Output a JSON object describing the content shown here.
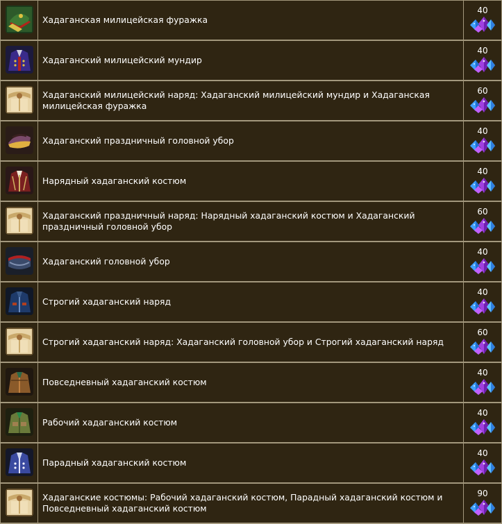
{
  "items": [
    {
      "name": "Хадаганская милицейская фуражка",
      "price": "40",
      "icon": "cap-icon"
    },
    {
      "name": "Хадаганский милицейский мундир",
      "price": "40",
      "icon": "uniform-icon"
    },
    {
      "name": "Хадаганский милицейский наряд: Хадаганский милицейский мундир и Хадаганская милицейская фуражка",
      "price": "60",
      "icon": "bundle-icon"
    },
    {
      "name": "Хадаганский праздничный головной убор",
      "price": "40",
      "icon": "headgear-icon"
    },
    {
      "name": "Нарядный хадаганский костюм",
      "price": "40",
      "icon": "suit-icon"
    },
    {
      "name": "Хадаганский праздничный наряд: Нарядный хадаганский костюм и Хадаганский праздничный головной убор",
      "price": "60",
      "icon": "bundle-icon"
    },
    {
      "name": "Хадаганский головной убор",
      "price": "40",
      "icon": "hat-icon"
    },
    {
      "name": "Строгий хадаганский наряд",
      "price": "40",
      "icon": "strict-suit-icon"
    },
    {
      "name": "Строгий хадаганский наряд: Хадаганский головной убор и Строгий хадаганский наряд",
      "price": "60",
      "icon": "bundle-icon"
    },
    {
      "name": "Повседневный хадаганский костюм",
      "price": "40",
      "icon": "casual-suit-icon"
    },
    {
      "name": "Рабочий хадаганский костюм",
      "price": "40",
      "icon": "work-suit-icon"
    },
    {
      "name": "Парадный хадаганский костюм",
      "price": "40",
      "icon": "parade-suit-icon"
    },
    {
      "name": "Хадаганские костюмы: Рабочий хадаганский костюм, Парадный хадаганский костюм и Повседневный хадаганский костюм",
      "price": "90",
      "icon": "bundle-icon"
    }
  ],
  "currency_icon": "crystal-currency-icon",
  "colors": {
    "background": "#2f2512",
    "grid_line": "#a3987d",
    "text": "#ffffff",
    "crystal_blue": "#3fa0ff",
    "crystal_purple": "#a040e0"
  }
}
